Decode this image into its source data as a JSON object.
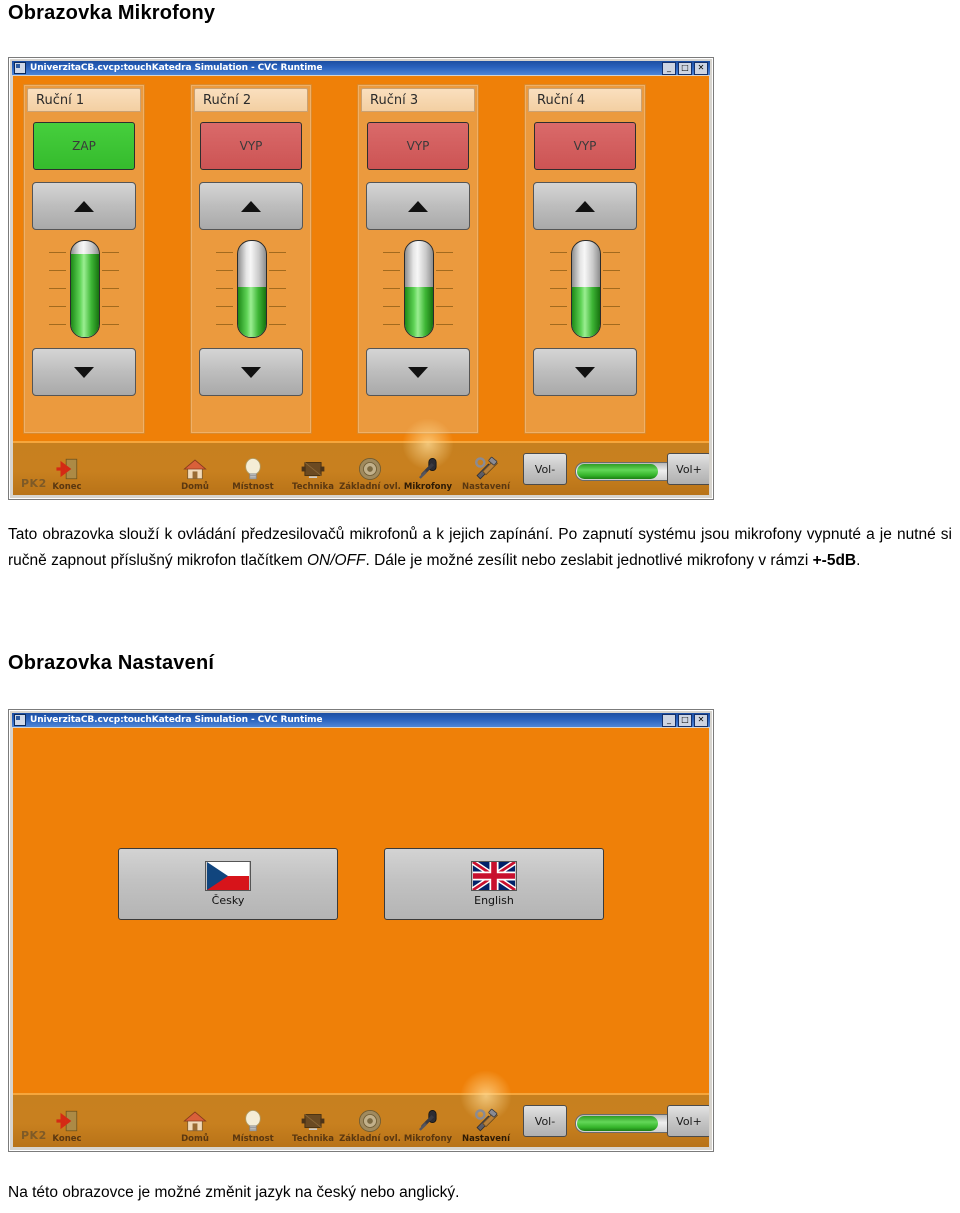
{
  "document": {
    "heading_microphones": "Obrazovka Mikrofony",
    "heading_settings": "Obrazovka Nastavení",
    "paragraph_microphones_1": "Tato obrazovka slouží k ovládání předzesilovačů mikrofonů a k jejich zapínání. Po zapnutí systému jsou mikrofony vypnuté a je nutné si ručně zapnout příslušný mikrofon tlačítkem ",
    "paragraph_microphones_em": "ON/OFF",
    "paragraph_microphones_2": ". Dále je možné zesílit nebo zeslabit jednotlivé mikrofony v rámzi ",
    "paragraph_microphones_bold": "+-5dB",
    "paragraph_microphones_3": ".",
    "paragraph_settings": "Na této obrazovce je možné změnit jazyk na český nebo anglický."
  },
  "window": {
    "title": "UniverzitaCB.cvcp:touchKatedra Simulation - CVC Runtime",
    "app_icon": "app-window-icon",
    "controls": {
      "minimize": "_",
      "maximize": "□",
      "close": "✕"
    },
    "background_color": "#ef8008",
    "titlebar_color": "#2a62bd"
  },
  "microphone_screen": {
    "channels": [
      {
        "label": "Ruční 1",
        "state_label": "ZAP",
        "state": "on",
        "gain_percent": 86,
        "up_icon": "triangle-up-icon",
        "down_icon": "triangle-down-icon"
      },
      {
        "label": "Ruční 2",
        "state_label": "VYP",
        "state": "off",
        "gain_percent": 52,
        "up_icon": "triangle-up-icon",
        "down_icon": "triangle-down-icon"
      },
      {
        "label": "Ruční 3",
        "state_label": "VYP",
        "state": "off",
        "gain_percent": 52,
        "up_icon": "triangle-up-icon",
        "down_icon": "triangle-down-icon"
      },
      {
        "label": "Ruční 4",
        "state_label": "VYP",
        "state": "off",
        "gain_percent": 52,
        "up_icon": "triangle-up-icon",
        "down_icon": "triangle-down-icon"
      }
    ],
    "colors": {
      "on": "#3fc33f",
      "off": "#cf5b5b",
      "panel": "#eb9a3e"
    }
  },
  "settings_screen": {
    "languages": [
      {
        "name": "Česky",
        "flag": "czech-flag-icon"
      },
      {
        "name": "English",
        "flag": "uk-flag-icon"
      }
    ]
  },
  "toolbar": {
    "system_label": "PK2",
    "items": [
      {
        "label": "Konec",
        "icon": "exit-door-icon",
        "active": false
      },
      {
        "label": "Domů",
        "icon": "house-icon",
        "active": false
      },
      {
        "label": "Místnost",
        "icon": "lightbulb-icon",
        "active": false
      },
      {
        "label": "Technika",
        "icon": "projector-icon",
        "active": false
      },
      {
        "label": "Základní ovl.",
        "icon": "knob-dial-icon",
        "active": false
      },
      {
        "label": "Mikrofony",
        "icon": "microphone-icon",
        "active": true
      },
      {
        "label": "Nastavení",
        "icon": "tools-icon",
        "active": false
      }
    ],
    "items_settings_active": [
      {
        "label": "Konec",
        "icon": "exit-door-icon",
        "active": false
      },
      {
        "label": "Domů",
        "icon": "house-icon",
        "active": false
      },
      {
        "label": "Místnost",
        "icon": "lightbulb-icon",
        "active": false
      },
      {
        "label": "Technika",
        "icon": "projector-icon",
        "active": false
      },
      {
        "label": "Základní ovl.",
        "icon": "knob-dial-icon",
        "active": false
      },
      {
        "label": "Mikrofony",
        "icon": "microphone-icon",
        "active": false
      },
      {
        "label": "Nastavení",
        "icon": "tools-icon",
        "active": true
      }
    ],
    "volume_down": "Vol-",
    "volume_up": "Vol+",
    "volume_percent": 78
  }
}
